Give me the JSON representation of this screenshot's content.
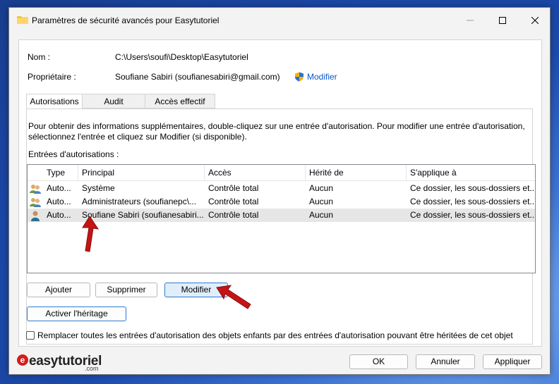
{
  "window": {
    "title": "Paramètres de sécurité avancés pour Easytutoriel"
  },
  "header": {
    "nom_label": "Nom :",
    "nom_value": "C:\\Users\\soufi\\Desktop\\Easytutoriel",
    "proprietaire_label": "Propriétaire :",
    "proprietaire_value": "Soufiane Sabiri (soufianesabiri@gmail.com)",
    "modifier_link": "Modifier"
  },
  "tabs": [
    {
      "label": "Autorisations",
      "active": true
    },
    {
      "label": "Audit",
      "active": false
    },
    {
      "label": "Accès effectif",
      "active": false
    }
  ],
  "info": {
    "line1": "Pour obtenir des informations supplémentaires, double-cliquez sur une entrée d'autorisation. Pour modifier une entrée d'autorisation,",
    "line2": "sélectionnez l'entrée et cliquez sur Modifier (si disponible).",
    "entries_label": "Entrées d'autorisations :"
  },
  "table": {
    "columns": [
      "Type",
      "Principal",
      "Accès",
      "Hérité de",
      "S'applique à"
    ],
    "rows": [
      {
        "type": "Auto...",
        "principal": "Système",
        "acces": "Contrôle total",
        "herite": "Aucun",
        "applique": "Ce dossier, les sous-dossiers et...",
        "icon": "group-users-icon",
        "selected": false
      },
      {
        "type": "Auto...",
        "principal": "Administrateurs (soufianepc\\...",
        "acces": "Contrôle total",
        "herite": "Aucun",
        "applique": "Ce dossier, les sous-dossiers et...",
        "icon": "group-users-icon",
        "selected": false
      },
      {
        "type": "Auto...",
        "principal": "Soufiane Sabiri (soufianesabiri...",
        "acces": "Contrôle total",
        "herite": "Aucun",
        "applique": "Ce dossier, les sous-dossiers et...",
        "icon": "single-user-icon",
        "selected": true
      }
    ]
  },
  "buttons": {
    "ajouter": "Ajouter",
    "supprimer": "Supprimer",
    "modifier": "Modifier",
    "activer_heritage": "Activer l'héritage",
    "ok": "OK",
    "annuler": "Annuler",
    "appliquer": "Appliquer"
  },
  "checkbox": {
    "label": "Remplacer toutes les entrées d'autorisation des objets enfants par des entrées d'autorisation pouvant être héritées de cet objet",
    "checked": false
  },
  "logo": {
    "text": "easytutoriel",
    "suffix": ".com"
  },
  "colors": {
    "accent": "#2d7ad0",
    "link": "#0a58ca",
    "arrow": "#c41414"
  }
}
